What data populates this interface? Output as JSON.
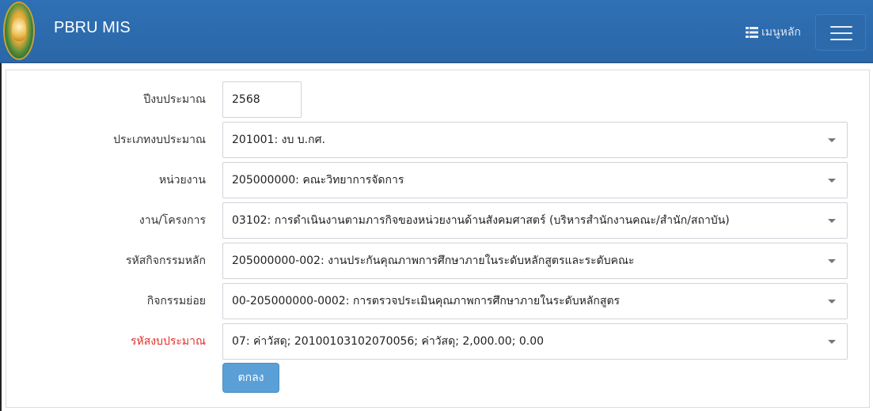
{
  "header": {
    "brand": "PBRU MIS",
    "menu_label": "เมนูหลัก"
  },
  "form": {
    "rows": [
      {
        "label": "ปีงบประมาณ",
        "value": "2568"
      },
      {
        "label": "ประเภทงบประมาณ",
        "value": "201001: งบ บ.กศ."
      },
      {
        "label": "หน่วยงาน",
        "value": "205000000: คณะวิทยาการจัดการ"
      },
      {
        "label": "งาน/โครงการ",
        "value": "03102: การดำเนินงานตามภารกิจของหน่วยงานด้านสังคมศาสตร์ (บริหารสำนักงานคณะ/สำนัก/สถาบัน)"
      },
      {
        "label": "รหัสกิจกรรมหลัก",
        "value": "205000000-002: งานประกันคุณภาพการศึกษาภายในระดับหลักสูตรและระดับคณะ"
      },
      {
        "label": "กิจกรรมย่อย",
        "value": "00-205000000-0002: การตรวจประเมินคุณภาพการศึกษาภายในระดับหลักสูตร"
      },
      {
        "label": "รหัสงบประมาณ",
        "value": "07: ค่าวัสดุ; 20100103102070056; ค่าวัสดุ; 2,000.00; 0.00"
      }
    ],
    "submit_label": "ตกลง"
  },
  "colors": {
    "navbar": "#2f70b4",
    "submit_button": "#5a9fd6",
    "required_label": "#e0312e"
  },
  "icons": {
    "menu": "list-icon",
    "toggle": "hamburger-icon",
    "dropdown": "caret-down-icon"
  }
}
